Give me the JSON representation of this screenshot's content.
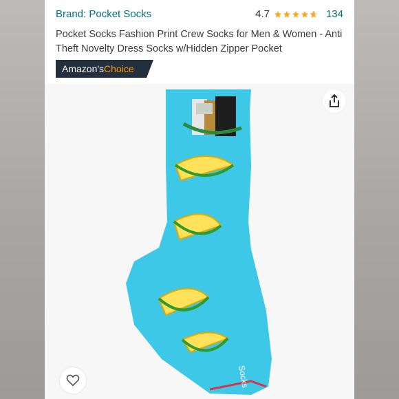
{
  "product": {
    "brand": "Brand: Pocket Socks",
    "rating_value": "4.7",
    "rating_stars": 4.7,
    "rating_count": "134",
    "title": "Pocket Socks Fashion Print Crew Socks for Men & Women - Anti Theft Novelty Dress Socks w/Hidden Zipper Pocket",
    "badge_prefix": "Amazon's",
    "badge_suffix": "Choice",
    "sock_label": "Socks"
  },
  "colors": {
    "brand_link": "#007185",
    "badge_bg": "#232f3e",
    "badge_accent": "#ff9900",
    "star": "#ffa41c",
    "sock": "#3cc8e6"
  },
  "icons": {
    "share": "share-icon",
    "favorite": "heart-icon",
    "star": "star-icon"
  }
}
